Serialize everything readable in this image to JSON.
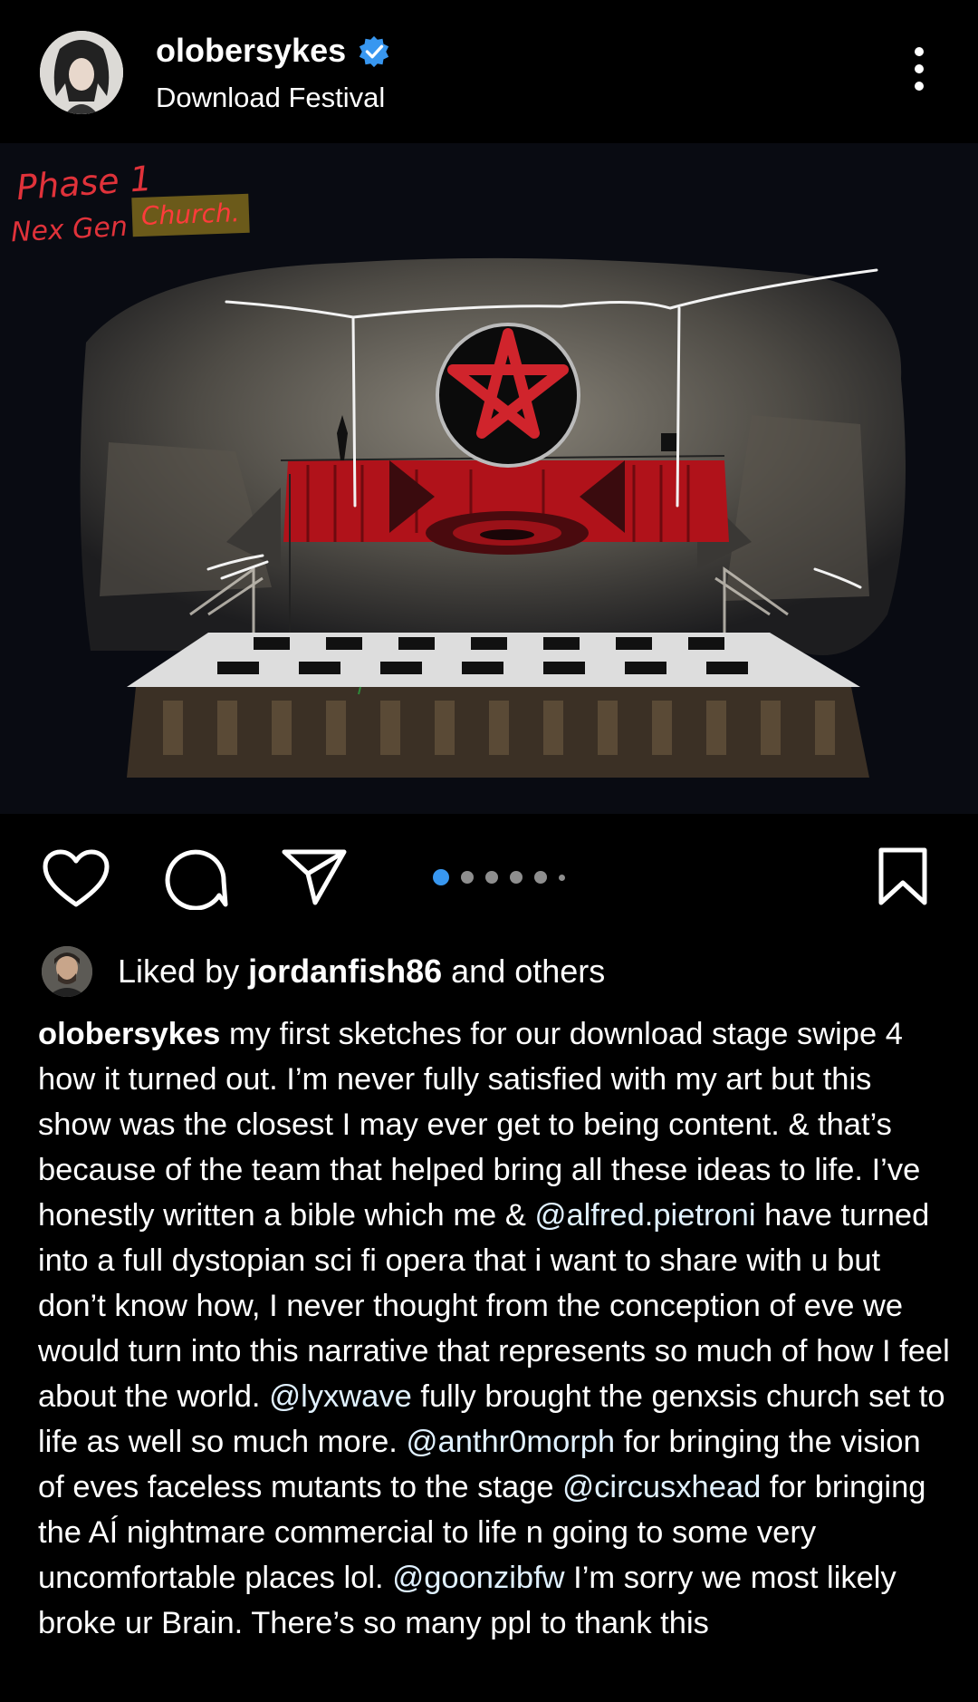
{
  "header": {
    "username": "olobersykes",
    "location": "Download Festival"
  },
  "image": {
    "note_phase": "Phase 1",
    "note_nex_gen": "Nex Gen",
    "note_church": "Church."
  },
  "actions": {
    "carousel_total": 6,
    "carousel_active": 1
  },
  "likes": {
    "prefix": "Liked by ",
    "user": "jordanfish86",
    "suffix": " and others"
  },
  "caption": {
    "author": "olobersykes",
    "p1": " my first sketches for our download stage swipe 4 how it turned out. I’m never fully satisfied with my art but this show was the closest I may ever get to being content. & that’s because of the team that helped bring all these ideas to life. I’ve honestly written a bible which me & ",
    "m1": "@alfred.pietroni",
    "p2": " have turned into a full dystopian sci fi opera that i want to share with u but don’t know how, I never thought from the conception of eve we would turn into this narrative that represents so much of how I feel about the world. ",
    "m2": "@lyxwave",
    "p3": " fully brought the genxsis church set to life as well so much more. ",
    "m3": "@anthr0morph",
    "p4": " for bringing the vision of eves faceless mutants to the stage ",
    "m4": "@circusxhead",
    "p5": " for bringing the AÍ nightmare commercial to life n going to some very uncomfortable places lol. ",
    "m5": "@goonzibfw",
    "p6": " I’m sorry we most likely broke ur Brain. There’s so many ppl to thank this"
  },
  "colors": {
    "background": "#000000",
    "verified_blue": "#3897f0",
    "active_dot": "#3897f0",
    "note_red": "#e0323a",
    "highlight": "#6b5a1a"
  }
}
